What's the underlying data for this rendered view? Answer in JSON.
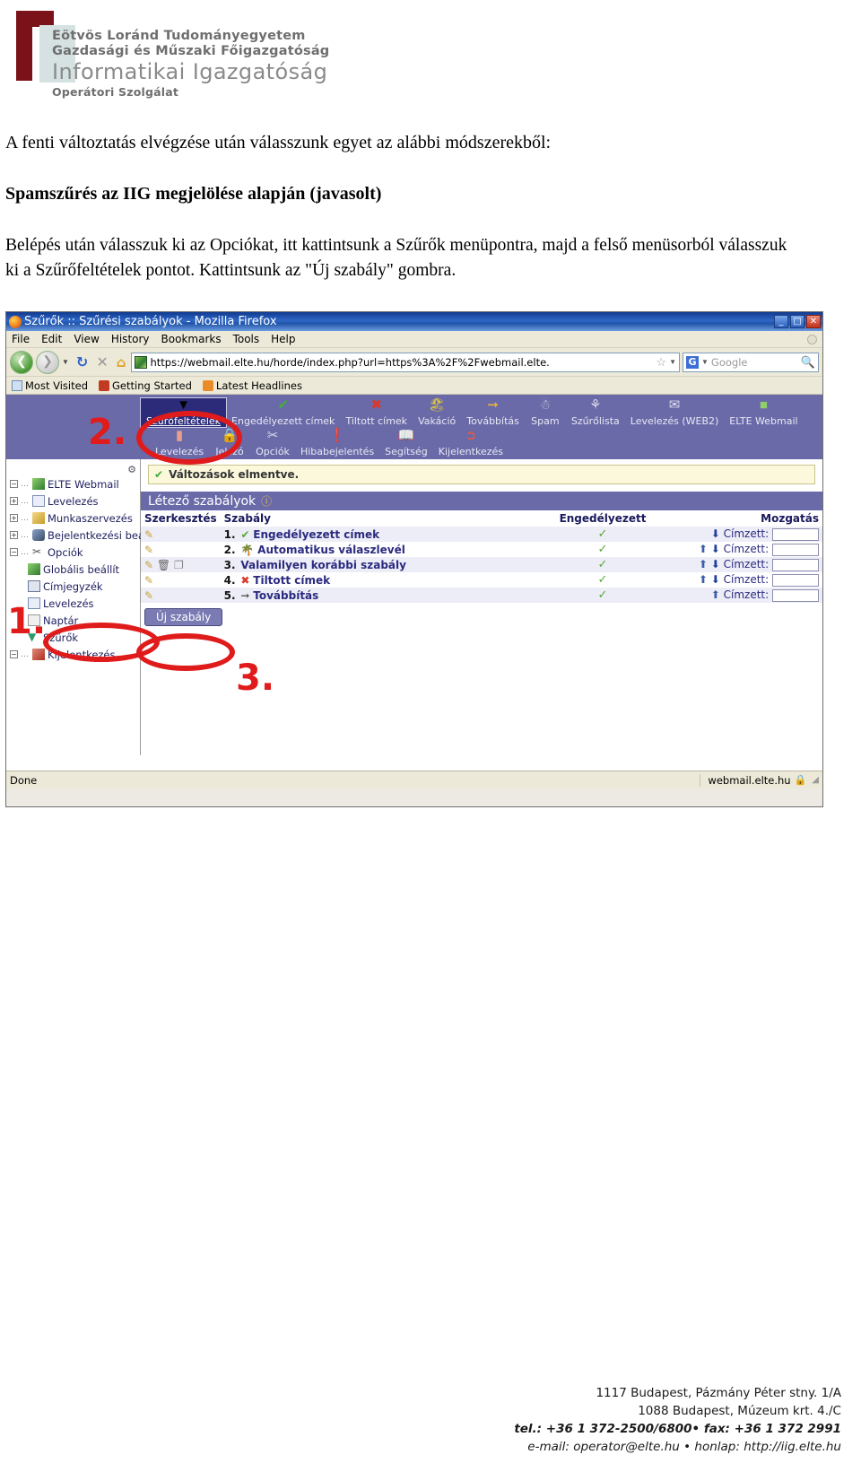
{
  "header": {
    "line1": "Eötvös Loránd Tudományegyetem",
    "line2": "Gazdasági és Műszaki Főigazgatóság",
    "line3": "Informatikai Igazgatóság",
    "line4": "Operátori Szolgálat",
    "accent_color": "#7b1119",
    "text_color": "#6e6e6e"
  },
  "document": {
    "intro": "A fenti változtatás elvégzése után válasszunk egyet az alábbi módszerekből:",
    "heading": "Spamszűrés az IIG megjelölése alapján (javasolt)",
    "steps": "Belépés után válasszuk ki az Opciókat, itt kattintsunk a Szűrők menüpontra, majd a felső menüsorból válasszuk ki a Szűrőfeltételek pontot. Kattintsunk az \"Új szabály\" gombra."
  },
  "browser": {
    "title": "Szűrők :: Szűrési szabályok - Mozilla Firefox",
    "window_buttons": [
      "_",
      "□",
      "✕"
    ],
    "menu": [
      "File",
      "Edit",
      "View",
      "History",
      "Bookmarks",
      "Tools",
      "Help"
    ],
    "url": "https://webmail.elte.hu/horde/index.php?url=https%3A%2F%2Fwebmail.elte.",
    "search_placeholder": "Google",
    "bookmarks": [
      "Most Visited",
      "Getting Started",
      "Latest Headlines"
    ],
    "status_left": "Done",
    "status_right": "webmail.elte.hu"
  },
  "horde": {
    "toolbar": [
      {
        "label": "Szűrőfeltételek",
        "icon": "filter-icon",
        "active": true
      },
      {
        "label": "Engedélyezett címek",
        "icon": "check-icon",
        "active": false
      },
      {
        "label": "Tiltott címek",
        "icon": "x-icon",
        "active": false
      },
      {
        "label": "Vakáció",
        "icon": "vacation-icon",
        "active": false
      },
      {
        "label": "Továbbítás",
        "icon": "forward-arrow-icon",
        "active": false
      },
      {
        "label": "Spam",
        "icon": "spam-icon",
        "active": false
      },
      {
        "label": "Szűrőlista",
        "icon": "filter-list-icon",
        "active": false
      },
      {
        "label": "Levelezés (WEB2)",
        "icon": "envelope-icon",
        "active": false
      },
      {
        "label": "ELTE Webmail",
        "icon": "webmail-icon",
        "active": false
      }
    ],
    "toolbar2": [
      {
        "label": "Levelezés",
        "icon": "mail-icon"
      },
      {
        "label": "Jelszó",
        "icon": "lock-icon"
      },
      {
        "label": "Opciók",
        "icon": "tools-icon"
      },
      {
        "label": "Hibabejelentés",
        "icon": "bug-report-icon"
      },
      {
        "label": "Segítség",
        "icon": "help-book-icon"
      },
      {
        "label": "Kijelentkezés",
        "icon": "logout-icon"
      }
    ],
    "sidebar": [
      {
        "label": "ELTE Webmail",
        "toggle": "minus",
        "depth": 0,
        "icon": "webmail-icon"
      },
      {
        "label": "Levelezés",
        "toggle": "plus",
        "depth": 0,
        "icon": "envelope-icon"
      },
      {
        "label": "Munkaszervezés",
        "toggle": "plus",
        "depth": 0,
        "icon": "calendar-icon"
      },
      {
        "label": "Bejelentkezési bea",
        "toggle": "plus",
        "depth": 0,
        "icon": "user-icon"
      },
      {
        "label": "Opciók",
        "toggle": "minus",
        "depth": 0,
        "icon": "tools-icon"
      },
      {
        "label": "Globális beállít",
        "toggle": "none",
        "depth": 1,
        "icon": "webmail-icon"
      },
      {
        "label": "Címjegyzék",
        "toggle": "none",
        "depth": 1,
        "icon": "addressbook-icon"
      },
      {
        "label": "Levelezés",
        "toggle": "none",
        "depth": 1,
        "icon": "envelope-icon"
      },
      {
        "label": "Naptár",
        "toggle": "none",
        "depth": 1,
        "icon": "calendar-icon"
      },
      {
        "label": "Szűrők",
        "toggle": "none",
        "depth": 1,
        "icon": "filter-icon"
      },
      {
        "label": "Kijelentkezés",
        "toggle": "minus",
        "depth": 0,
        "icon": "logout-icon"
      }
    ],
    "notice": "Változások elmentve.",
    "section_title": "Létező szabályok",
    "table": {
      "headers": [
        "Szerkesztés",
        "Szabály",
        "Engedélyezett",
        "Mozgatás"
      ],
      "rows": [
        {
          "num": "1.",
          "icon": "check-icon",
          "name": "Engedélyezett címek",
          "enabled": "✓",
          "up": false,
          "down": true,
          "move_label": "Címzett:",
          "edit_icons": [
            "edit-icon"
          ]
        },
        {
          "num": "2.",
          "icon": "vacation-icon",
          "name": "Automatikus válaszlevél",
          "enabled": "✓",
          "up": true,
          "down": true,
          "move_label": "Címzett:",
          "edit_icons": [
            "edit-icon"
          ]
        },
        {
          "num": "3.",
          "icon": "none",
          "name": "Valamilyen korábbi szabály",
          "enabled": "✓",
          "up": true,
          "down": true,
          "move_label": "Címzett:",
          "edit_icons": [
            "edit-icon",
            "delete-icon",
            "copy-icon"
          ]
        },
        {
          "num": "4.",
          "icon": "x-icon",
          "name": "Tiltott címek",
          "enabled": "✓",
          "up": true,
          "down": true,
          "move_label": "Címzett:",
          "edit_icons": [
            "edit-icon"
          ]
        },
        {
          "num": "5.",
          "icon": "forward-arrow-icon",
          "name": "Továbbítás",
          "enabled": "✓",
          "up": true,
          "down": false,
          "move_label": "Címzett:",
          "edit_icons": [
            "edit-icon"
          ]
        }
      ]
    },
    "new_rule_button": "Új szabály"
  },
  "annotations": {
    "step1": "1.",
    "step2": "2.",
    "step3": "3.",
    "color": "#e01b1b"
  },
  "footer": {
    "line1": "1117 Budapest, Pázmány Péter stny. 1/A",
    "line2": "1088 Budapest, Múzeum krt. 4./C",
    "line3": "tel.: +36 1 372-2500/6800• fax: +36 1 372 2991",
    "line4": "e-mail: operator@elte.hu • honlap: http://iig.elte.hu"
  }
}
